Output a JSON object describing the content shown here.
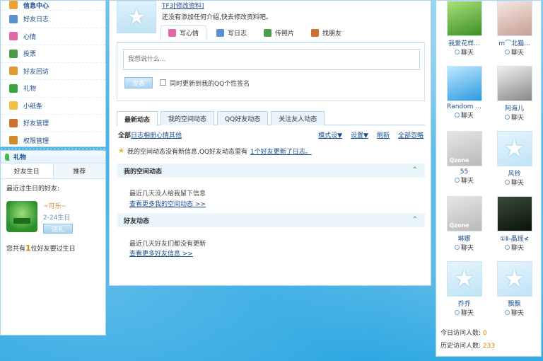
{
  "left_nav": {
    "title": "信息中心",
    "items": [
      {
        "label": "好友日志",
        "icon": "blog-icon",
        "color": "#5a8fd0"
      },
      {
        "label": "心情",
        "icon": "heart-icon",
        "color": "#e468a8"
      },
      {
        "label": "投票",
        "icon": "vote-icon",
        "color": "#4a9a4a"
      },
      {
        "label": "好友回访",
        "icon": "visit-icon",
        "color": "#e09a30"
      },
      {
        "label": "礼物",
        "icon": "gift-icon",
        "color": "#3aa63a"
      },
      {
        "label": "小纸条",
        "icon": "note-icon",
        "color": "#f0c040"
      },
      {
        "label": "好友管理",
        "icon": "friends-icon",
        "color": "#d07030"
      },
      {
        "label": "权限管理",
        "icon": "lock-icon",
        "color": "#d08a30"
      }
    ]
  },
  "left_friends": {
    "title": "礼物",
    "tab_birthday": "好友生日",
    "tab_other": "推荐",
    "recent_label": "最近过生日的好友:",
    "friend_name": "~可乐~",
    "friend_date": "2-24生日",
    "friend_btn": "送礼",
    "count_prefix": "您共有",
    "count_num": "1",
    "count_suffix": "位好友要过生日"
  },
  "center": {
    "my_name": "TF3[修改资料]",
    "my_desc": "还没有添加任何介绍,快去修改资料吧。",
    "tabs": [
      {
        "label": "写心情",
        "icon": "mood-icon",
        "color": "#e468a8"
      },
      {
        "label": "写日志",
        "icon": "blog-icon",
        "color": "#5a8fd0"
      },
      {
        "label": "传照片",
        "icon": "photo-icon",
        "color": "#4a9a4a"
      },
      {
        "label": "找朋友",
        "icon": "find-friend-icon",
        "color": "#d07030"
      }
    ],
    "mood_placeholder": "我想说什么...",
    "publish_btn": "发表",
    "sync_label": "同时更新到我的QQ个性签名",
    "feed_tabs": [
      "最新动态",
      "我的空间动态",
      "QQ好友动态",
      "关注友人动态"
    ],
    "filter_all": "全部",
    "filter_items": "日志相册心情其他",
    "filter_mode": "模式设▼",
    "filter_settings": "设置▼",
    "filter_refresh": "刷新",
    "filter_allread": "全部忽略",
    "notice_prefix": "我的空间动态没有新信息,QQ好友动态里有",
    "notice_link": "1个好友更新了日志。",
    "sec1_title": "我的空间动态",
    "sec1_text": "最近几天没人给我留下信息",
    "sec1_link": "查看更多我的空间动态 >>",
    "sec2_title": "好友动态",
    "sec2_text": "最近几天好友们都没有更新",
    "sec2_link": "查看更多好友信息 >>"
  },
  "right": {
    "chat_label": "聊天",
    "friends": [
      {
        "name": "我爱花样...",
        "thumb": "th-green",
        "kind": "photo"
      },
      {
        "name": "m⌒北猫...",
        "thumb": "th-portrait",
        "kind": "photo"
      },
      {
        "name": "Random ...",
        "thumb": "th-blue",
        "kind": "photo"
      },
      {
        "name": "阿海儿",
        "thumb": "th-couple",
        "kind": "photo"
      },
      {
        "name": "55",
        "thumb": "th-qzone",
        "kind": "qzone"
      },
      {
        "name": "风铃",
        "thumb": "th-star",
        "kind": "star"
      },
      {
        "name": "琳娜",
        "thumb": "th-qzone",
        "kind": "qzone"
      },
      {
        "name": "①Ⅱ-晶瑶≮",
        "thumb": "th-dark",
        "kind": "photo"
      },
      {
        "name": "乔乔",
        "thumb": "th-star",
        "kind": "star"
      },
      {
        "name": "飘飘",
        "thumb": "th-star",
        "kind": "star"
      }
    ],
    "qzone_text": "Qzone",
    "today_label": "今日访问人数:",
    "today_value": "0",
    "total_label": "历史访问人数:",
    "total_value": "233"
  }
}
